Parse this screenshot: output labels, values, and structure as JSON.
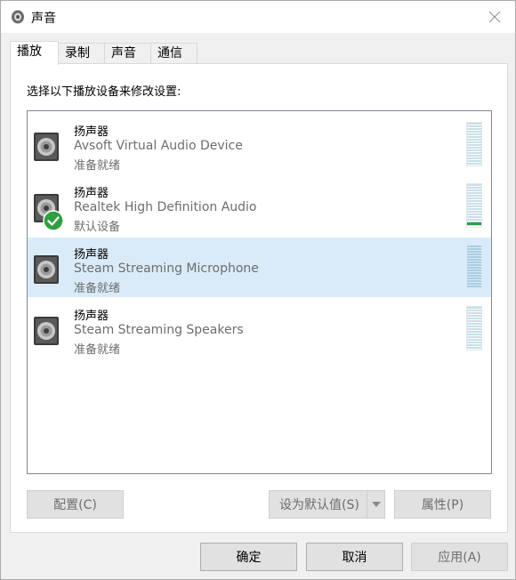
{
  "window": {
    "title": "声音"
  },
  "tabs": [
    {
      "label": "播放"
    },
    {
      "label": "录制"
    },
    {
      "label": "声音"
    },
    {
      "label": "通信"
    }
  ],
  "playback": {
    "instruction": "选择以下播放设备来修改设置:",
    "devices": [
      {
        "type": "扬声器",
        "name": "Avsoft Virtual Audio Device",
        "status": "准备就绪",
        "is_default": false,
        "selected": false,
        "level": 0
      },
      {
        "type": "扬声器",
        "name": "Realtek High Definition Audio",
        "status": "默认设备",
        "is_default": true,
        "selected": false,
        "level": 0.05
      },
      {
        "type": "扬声器",
        "name": "Steam Streaming Microphone",
        "status": "准备就绪",
        "is_default": false,
        "selected": true,
        "level": 0
      },
      {
        "type": "扬声器",
        "name": "Steam Streaming Speakers",
        "status": "准备就绪",
        "is_default": false,
        "selected": false,
        "level": 0
      }
    ],
    "buttons": {
      "configure": "配置(C)",
      "set_default": "设为默认值(S)",
      "properties": "属性(P)"
    }
  },
  "footer": {
    "ok": "确定",
    "cancel": "取消",
    "apply": "应用(A)"
  },
  "colors": {
    "selection": "#d9ebf9",
    "default_badge": "#2f9e3e",
    "meter": "#c9dfe8"
  }
}
